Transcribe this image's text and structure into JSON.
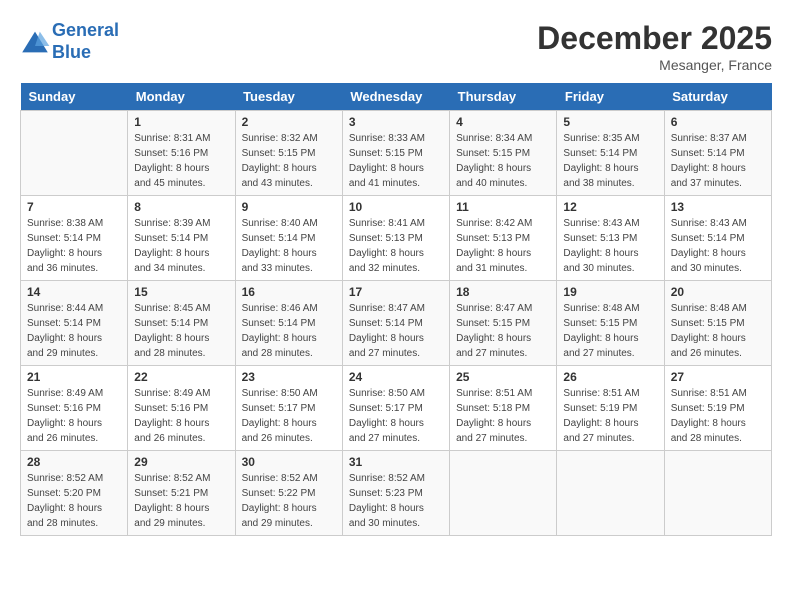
{
  "logo": {
    "line1": "General",
    "line2": "Blue"
  },
  "title": "December 2025",
  "location": "Mesanger, France",
  "days_of_week": [
    "Sunday",
    "Monday",
    "Tuesday",
    "Wednesday",
    "Thursday",
    "Friday",
    "Saturday"
  ],
  "weeks": [
    [
      {
        "num": "",
        "sunrise": "",
        "sunset": "",
        "daylight": ""
      },
      {
        "num": "1",
        "sunrise": "Sunrise: 8:31 AM",
        "sunset": "Sunset: 5:16 PM",
        "daylight": "Daylight: 8 hours and 45 minutes."
      },
      {
        "num": "2",
        "sunrise": "Sunrise: 8:32 AM",
        "sunset": "Sunset: 5:15 PM",
        "daylight": "Daylight: 8 hours and 43 minutes."
      },
      {
        "num": "3",
        "sunrise": "Sunrise: 8:33 AM",
        "sunset": "Sunset: 5:15 PM",
        "daylight": "Daylight: 8 hours and 41 minutes."
      },
      {
        "num": "4",
        "sunrise": "Sunrise: 8:34 AM",
        "sunset": "Sunset: 5:15 PM",
        "daylight": "Daylight: 8 hours and 40 minutes."
      },
      {
        "num": "5",
        "sunrise": "Sunrise: 8:35 AM",
        "sunset": "Sunset: 5:14 PM",
        "daylight": "Daylight: 8 hours and 38 minutes."
      },
      {
        "num": "6",
        "sunrise": "Sunrise: 8:37 AM",
        "sunset": "Sunset: 5:14 PM",
        "daylight": "Daylight: 8 hours and 37 minutes."
      }
    ],
    [
      {
        "num": "7",
        "sunrise": "Sunrise: 8:38 AM",
        "sunset": "Sunset: 5:14 PM",
        "daylight": "Daylight: 8 hours and 36 minutes."
      },
      {
        "num": "8",
        "sunrise": "Sunrise: 8:39 AM",
        "sunset": "Sunset: 5:14 PM",
        "daylight": "Daylight: 8 hours and 34 minutes."
      },
      {
        "num": "9",
        "sunrise": "Sunrise: 8:40 AM",
        "sunset": "Sunset: 5:14 PM",
        "daylight": "Daylight: 8 hours and 33 minutes."
      },
      {
        "num": "10",
        "sunrise": "Sunrise: 8:41 AM",
        "sunset": "Sunset: 5:13 PM",
        "daylight": "Daylight: 8 hours and 32 minutes."
      },
      {
        "num": "11",
        "sunrise": "Sunrise: 8:42 AM",
        "sunset": "Sunset: 5:13 PM",
        "daylight": "Daylight: 8 hours and 31 minutes."
      },
      {
        "num": "12",
        "sunrise": "Sunrise: 8:43 AM",
        "sunset": "Sunset: 5:13 PM",
        "daylight": "Daylight: 8 hours and 30 minutes."
      },
      {
        "num": "13",
        "sunrise": "Sunrise: 8:43 AM",
        "sunset": "Sunset: 5:14 PM",
        "daylight": "Daylight: 8 hours and 30 minutes."
      }
    ],
    [
      {
        "num": "14",
        "sunrise": "Sunrise: 8:44 AM",
        "sunset": "Sunset: 5:14 PM",
        "daylight": "Daylight: 8 hours and 29 minutes."
      },
      {
        "num": "15",
        "sunrise": "Sunrise: 8:45 AM",
        "sunset": "Sunset: 5:14 PM",
        "daylight": "Daylight: 8 hours and 28 minutes."
      },
      {
        "num": "16",
        "sunrise": "Sunrise: 8:46 AM",
        "sunset": "Sunset: 5:14 PM",
        "daylight": "Daylight: 8 hours and 28 minutes."
      },
      {
        "num": "17",
        "sunrise": "Sunrise: 8:47 AM",
        "sunset": "Sunset: 5:14 PM",
        "daylight": "Daylight: 8 hours and 27 minutes."
      },
      {
        "num": "18",
        "sunrise": "Sunrise: 8:47 AM",
        "sunset": "Sunset: 5:15 PM",
        "daylight": "Daylight: 8 hours and 27 minutes."
      },
      {
        "num": "19",
        "sunrise": "Sunrise: 8:48 AM",
        "sunset": "Sunset: 5:15 PM",
        "daylight": "Daylight: 8 hours and 27 minutes."
      },
      {
        "num": "20",
        "sunrise": "Sunrise: 8:48 AM",
        "sunset": "Sunset: 5:15 PM",
        "daylight": "Daylight: 8 hours and 26 minutes."
      }
    ],
    [
      {
        "num": "21",
        "sunrise": "Sunrise: 8:49 AM",
        "sunset": "Sunset: 5:16 PM",
        "daylight": "Daylight: 8 hours and 26 minutes."
      },
      {
        "num": "22",
        "sunrise": "Sunrise: 8:49 AM",
        "sunset": "Sunset: 5:16 PM",
        "daylight": "Daylight: 8 hours and 26 minutes."
      },
      {
        "num": "23",
        "sunrise": "Sunrise: 8:50 AM",
        "sunset": "Sunset: 5:17 PM",
        "daylight": "Daylight: 8 hours and 26 minutes."
      },
      {
        "num": "24",
        "sunrise": "Sunrise: 8:50 AM",
        "sunset": "Sunset: 5:17 PM",
        "daylight": "Daylight: 8 hours and 27 minutes."
      },
      {
        "num": "25",
        "sunrise": "Sunrise: 8:51 AM",
        "sunset": "Sunset: 5:18 PM",
        "daylight": "Daylight: 8 hours and 27 minutes."
      },
      {
        "num": "26",
        "sunrise": "Sunrise: 8:51 AM",
        "sunset": "Sunset: 5:19 PM",
        "daylight": "Daylight: 8 hours and 27 minutes."
      },
      {
        "num": "27",
        "sunrise": "Sunrise: 8:51 AM",
        "sunset": "Sunset: 5:19 PM",
        "daylight": "Daylight: 8 hours and 28 minutes."
      }
    ],
    [
      {
        "num": "28",
        "sunrise": "Sunrise: 8:52 AM",
        "sunset": "Sunset: 5:20 PM",
        "daylight": "Daylight: 8 hours and 28 minutes."
      },
      {
        "num": "29",
        "sunrise": "Sunrise: 8:52 AM",
        "sunset": "Sunset: 5:21 PM",
        "daylight": "Daylight: 8 hours and 29 minutes."
      },
      {
        "num": "30",
        "sunrise": "Sunrise: 8:52 AM",
        "sunset": "Sunset: 5:22 PM",
        "daylight": "Daylight: 8 hours and 29 minutes."
      },
      {
        "num": "31",
        "sunrise": "Sunrise: 8:52 AM",
        "sunset": "Sunset: 5:23 PM",
        "daylight": "Daylight: 8 hours and 30 minutes."
      },
      {
        "num": "",
        "sunrise": "",
        "sunset": "",
        "daylight": ""
      },
      {
        "num": "",
        "sunrise": "",
        "sunset": "",
        "daylight": ""
      },
      {
        "num": "",
        "sunrise": "",
        "sunset": "",
        "daylight": ""
      }
    ]
  ]
}
